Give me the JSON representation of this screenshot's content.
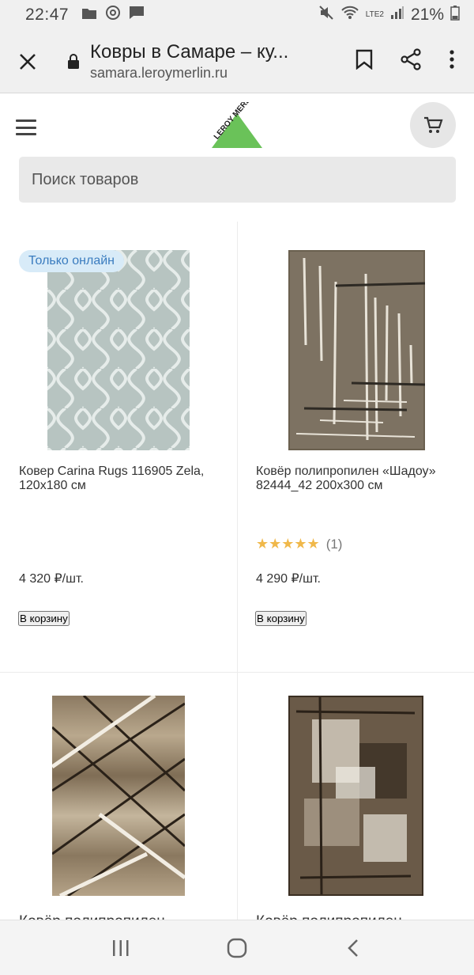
{
  "status": {
    "time": "22:47",
    "battery": "21%",
    "network": "LTE2"
  },
  "browser": {
    "title": "Ковры в Самаре – ку...",
    "url": "samara.leroymerlin.ru"
  },
  "site": {
    "logo_text": "LEROY MERLIN",
    "search_placeholder": "Поиск товаров"
  },
  "products": [
    {
      "badge": "Только онлайн",
      "name": "Ковер Carina Rugs 116905 Zela, 120x180 см",
      "price": "4 320",
      "unit": "₽/шт.",
      "button": "В корзину"
    },
    {
      "name": "Ковёр полипропилен «Шадоу» 82444_42 200x300 см",
      "rating_stars": "★★★★★",
      "rating_count": "(1)",
      "price": "4 290",
      "unit": "₽/шт.",
      "button": "В корзину"
    },
    {
      "name": "Ковёр полипропилен"
    },
    {
      "name": "Ковёр полипропилен"
    }
  ],
  "colors": {
    "button": "#464c5a",
    "badge_bg": "#d8ebf8",
    "badge_text": "#3a7cbf",
    "logo_green": "#6ac259",
    "star": "#f0b84a"
  }
}
